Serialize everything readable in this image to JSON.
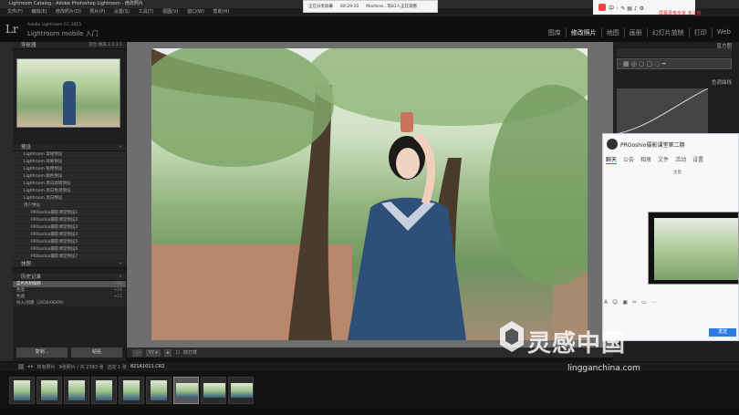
{
  "window": {
    "title": "Lightroom Catalog - Adobe Photoshop Lightroom - 修改照片",
    "menu": [
      "文件(F)",
      "编辑(E)",
      "修改照片(D)",
      "照片(P)",
      "设置(S)",
      "工具(T)",
      "视图(V)",
      "窗口(W)",
      "帮助(H)"
    ]
  },
  "share_bar": {
    "label": "正在分享屏幕",
    "timer": "00:29:10",
    "viewers": "Machine...等81人正在观看"
  },
  "tray": {
    "recording_note": "屏幕录像专家 未注册"
  },
  "identity": {
    "logo": "Lr",
    "catalog": "Adobe Lightroom CC 2015",
    "mobile": "Lightroom mobile 入门"
  },
  "modules": [
    "图库",
    "修改照片",
    "地图",
    "画册",
    "幻灯片放映",
    "打印",
    "Web"
  ],
  "left_panel": {
    "navigator": {
      "title": "导航器",
      "zoom": [
        "适合",
        "填满",
        "1:1",
        "3:1"
      ]
    },
    "presets": {
      "title": "预设",
      "items": [
        "Lightroom 常规预设",
        "Lightroom 效果预设",
        "Lightroom 锐用预设",
        "Lightroom 颜色预设",
        "Lightroom 黑白滤镜预设",
        "Lightroom 黑白色调预设",
        "Lightroom 黑白预设",
        "用户预设"
      ],
      "user_items": [
        "PROoshio摄影课堂预设1",
        "PROoshio摄影课堂预设2",
        "PROoshio摄影课堂预设3",
        "PROoshio摄影课堂预设4",
        "PROoshio摄影课堂预设5",
        "PROoshio摄影课堂预设6",
        "PROoshio摄影课堂预设7"
      ]
    },
    "snapshots": {
      "title": "快照"
    },
    "history": {
      "title": "历史记录",
      "items": [
        {
          "label": "蓝色色相偏移",
          "value": "+19"
        },
        {
          "label": "色温",
          "value": "+16"
        },
        {
          "label": "色调",
          "value": "+15"
        },
        {
          "label": "导入/创建（2016/06/09）",
          "value": ""
        }
      ]
    },
    "buttons": {
      "copy": "复制...",
      "paste": "粘贴"
    }
  },
  "toolbar": {
    "soft_proof": "软打样"
  },
  "right_panel": {
    "histogram_title": "直方图",
    "curve_title": "色调曲线"
  },
  "chat": {
    "title": "PROoshio摄影课堂第二期",
    "tabs": [
      "聊天",
      "公告",
      "相册",
      "文件",
      "活动",
      "设置"
    ],
    "inner_label": "注意",
    "send": "发送"
  },
  "filmstrip": {
    "source": "所有照片",
    "count": "9张照片 / 共 2393 张",
    "selected": "选定 1 张",
    "filename": "821A1011.CR2"
  },
  "watermark": {
    "text": "灵感中国",
    "url": "lingganchina.com"
  }
}
